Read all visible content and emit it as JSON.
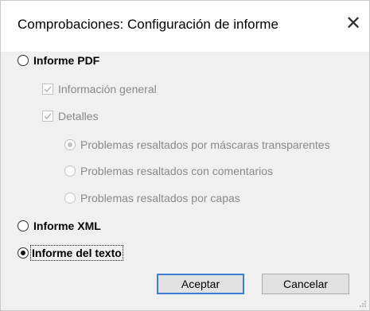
{
  "window": {
    "title": "Comprobaciones: Configuración de informe",
    "close_symbol": "✕"
  },
  "options": {
    "pdf_report": {
      "label": "Informe PDF",
      "selected": false
    },
    "general_info": {
      "label": "Información general",
      "checked": true,
      "enabled": false
    },
    "details": {
      "label": "Detalles",
      "checked": true,
      "enabled": false
    },
    "transparent_masks": {
      "label": "Problemas resaltados por máscaras transparentes",
      "selected": true,
      "enabled": false
    },
    "comments": {
      "label": "Problemas resaltados con comentarios",
      "selected": false,
      "enabled": false
    },
    "layers": {
      "label": "Problemas resaltados por capas",
      "selected": false,
      "enabled": false
    },
    "xml_report": {
      "label": "Informe XML",
      "selected": false
    },
    "text_report": {
      "label": "Informe del texto",
      "selected": true
    }
  },
  "buttons": {
    "accept": "Aceptar",
    "cancel": "Cancelar"
  }
}
